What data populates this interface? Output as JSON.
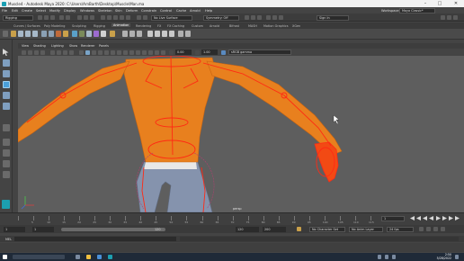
{
  "window": {
    "title": "Muscle4 - Autodesk Maya 2020: C:\\Users\\ArnBarth\\Desktop\\Muscle\\Man.ma",
    "minimize": "–",
    "maximize": "□",
    "close": "✕"
  },
  "menubar": {
    "items": [
      "File",
      "Edit",
      "Create",
      "Select",
      "Modify",
      "Display",
      "Windows",
      "Skeleton",
      "Skin",
      "Deform",
      "Constrain",
      "Control",
      "Cache",
      "Arnold",
      "Help"
    ],
    "workspace_label": "Workspace:",
    "workspace_value": "Maya Classic*"
  },
  "statusline": {
    "menuset": "Rigging",
    "live_surface": "No Live Surface",
    "symmetry": "Symmetry: Off",
    "sign_in": "Sign In"
  },
  "shelf": {
    "tabs": [
      "Curves / Surfaces",
      "Poly Modeling",
      "Sculpting",
      "Rigging",
      "Animation",
      "Rendering",
      "FX",
      "FX Caching",
      "Custom",
      "Arnold",
      "Bifrost",
      "MASH",
      "Motion Graphics",
      "XGen"
    ],
    "active_tab": "Animation"
  },
  "viewport": {
    "menus": [
      "View",
      "Shading",
      "Lighting",
      "Show",
      "Renderer",
      "Panels"
    ],
    "near_clip": "0.00",
    "far_clip": "1.00",
    "color_space": "sRGB gamma",
    "camera_label": "persp",
    "colors": {
      "background": "#5e5e5e",
      "skin": "#e8801e",
      "rig": "#ff2a14",
      "shorts": "#8593ad"
    }
  },
  "timeslider": {
    "tick_labels": [
      "5",
      "10",
      "15",
      "20",
      "25",
      "30",
      "35",
      "40",
      "45",
      "50",
      "55",
      "60",
      "65",
      "70",
      "75",
      "80",
      "85",
      "90",
      "95",
      "100",
      "105",
      "110",
      "115"
    ],
    "current_frame": "1"
  },
  "rangeslider": {
    "start": "1",
    "playback_start": "1",
    "playback_end": "120",
    "end": "120",
    "anim_end": "200",
    "character_set": "No Character Set",
    "anim_layer": "No Anim Layer",
    "fps": "24 fps"
  },
  "commandline": {
    "label": "MEL"
  },
  "taskbar": {
    "time": "2:50",
    "date": "5/28/2022"
  }
}
